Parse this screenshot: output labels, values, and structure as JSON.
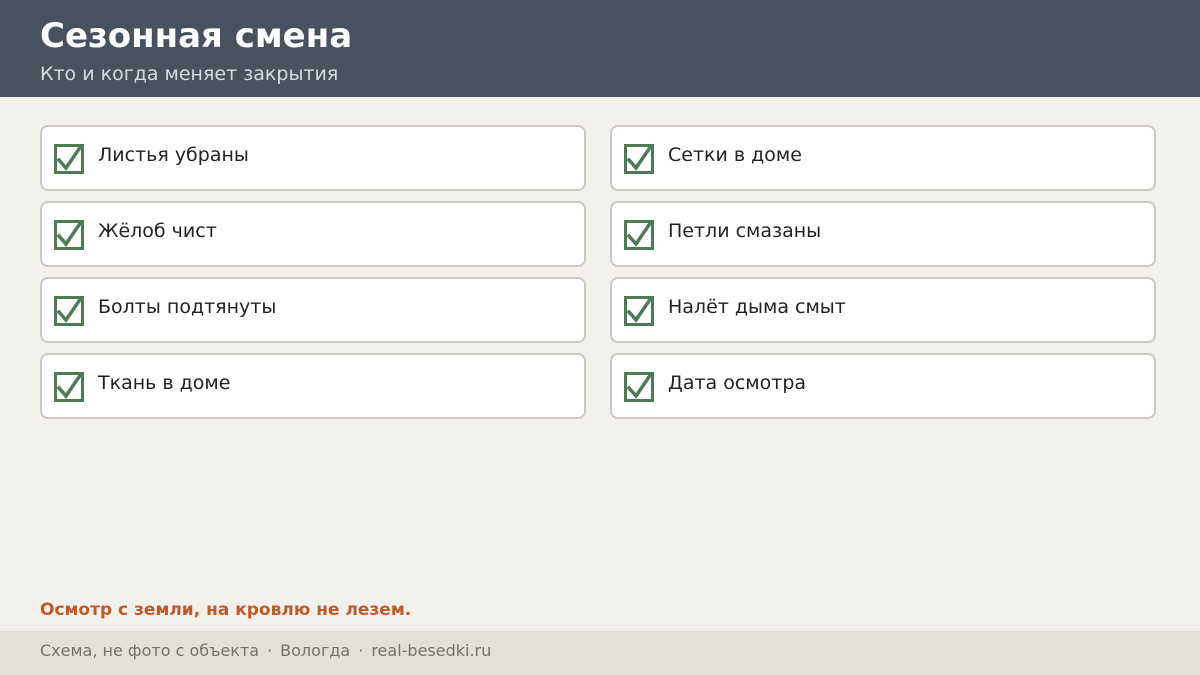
{
  "header": {
    "title": "Сезонная смена",
    "subtitle": "Кто и когда меняет закрытия"
  },
  "checklist": {
    "items": [
      {
        "label": "Листья убраны",
        "checked": true
      },
      {
        "label": "Сетки в доме",
        "checked": true
      },
      {
        "label": "Жёлоб чист",
        "checked": true
      },
      {
        "label": "Петли смазаны",
        "checked": true
      },
      {
        "label": "Болты подтянуты",
        "checked": true
      },
      {
        "label": "Налёт дыма смыт",
        "checked": true
      },
      {
        "label": "Ткань в доме",
        "checked": true
      },
      {
        "label": "Дата осмотра",
        "checked": true
      }
    ]
  },
  "note": "Осмотр с земли, на кровлю не лезем.",
  "footer": {
    "part1": "Схема, не фото с объекта",
    "separator": "·",
    "part2": "Вологда",
    "part3": "real-besedki.ru"
  },
  "colors": {
    "header_bg": "#48525e",
    "check_green": "#4e7a56",
    "accent_orange": "#c05a28",
    "page_bg": "#f3f1ec"
  }
}
